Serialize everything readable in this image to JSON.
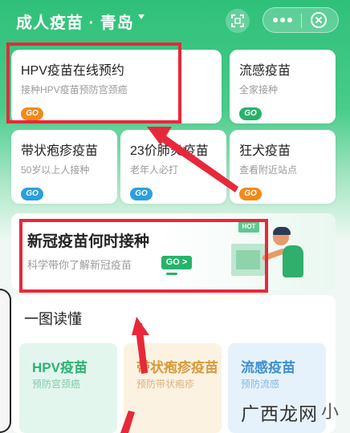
{
  "header": {
    "title": "成人疫苗 · 青岛",
    "scan_icon": "scan-icon",
    "more_icon": "more-dots-icon",
    "close_icon": "close-circle-icon"
  },
  "cards": [
    {
      "title": "HPV疫苗在线预约",
      "subtitle": "接种HPV疫苗预防宫颈癌",
      "go": "GO",
      "go_color": "#f08a1c"
    },
    {
      "title": "流感疫苗",
      "subtitle": "全家接种",
      "go": "GO",
      "go_color": "#26b36a"
    },
    {
      "title": "带状疱疹疫苗",
      "subtitle": "50岁以上人接种",
      "go": "GO",
      "go_color": "#2a9fe0"
    },
    {
      "title": "23价肺炎疫苗",
      "subtitle": "老年人必打",
      "go": "GO",
      "go_color": "#2a9fe0"
    },
    {
      "title": "狂犬疫苗",
      "subtitle": "查看附近站点",
      "go": "GO",
      "go_color": "#f08a1c"
    }
  ],
  "banner": {
    "title": "新冠疫苗何时接种",
    "subtitle": "科学带你了解新冠疫苗",
    "go": "GO >",
    "hot": "HOT"
  },
  "read": {
    "title": "一图读懂",
    "items": [
      {
        "title": "HPV疫苗",
        "subtitle": "预防宫颈癌"
      },
      {
        "title": "带状疱疹疫苗",
        "subtitle": "预防带状疱疹"
      },
      {
        "title": "流感疫苗",
        "subtitle": "预防流感"
      }
    ]
  },
  "watermark": {
    "text": "广西龙网",
    "logo": "小"
  },
  "colors": {
    "brand_green": "#2fc07a",
    "highlight_red": "#e8283a"
  }
}
